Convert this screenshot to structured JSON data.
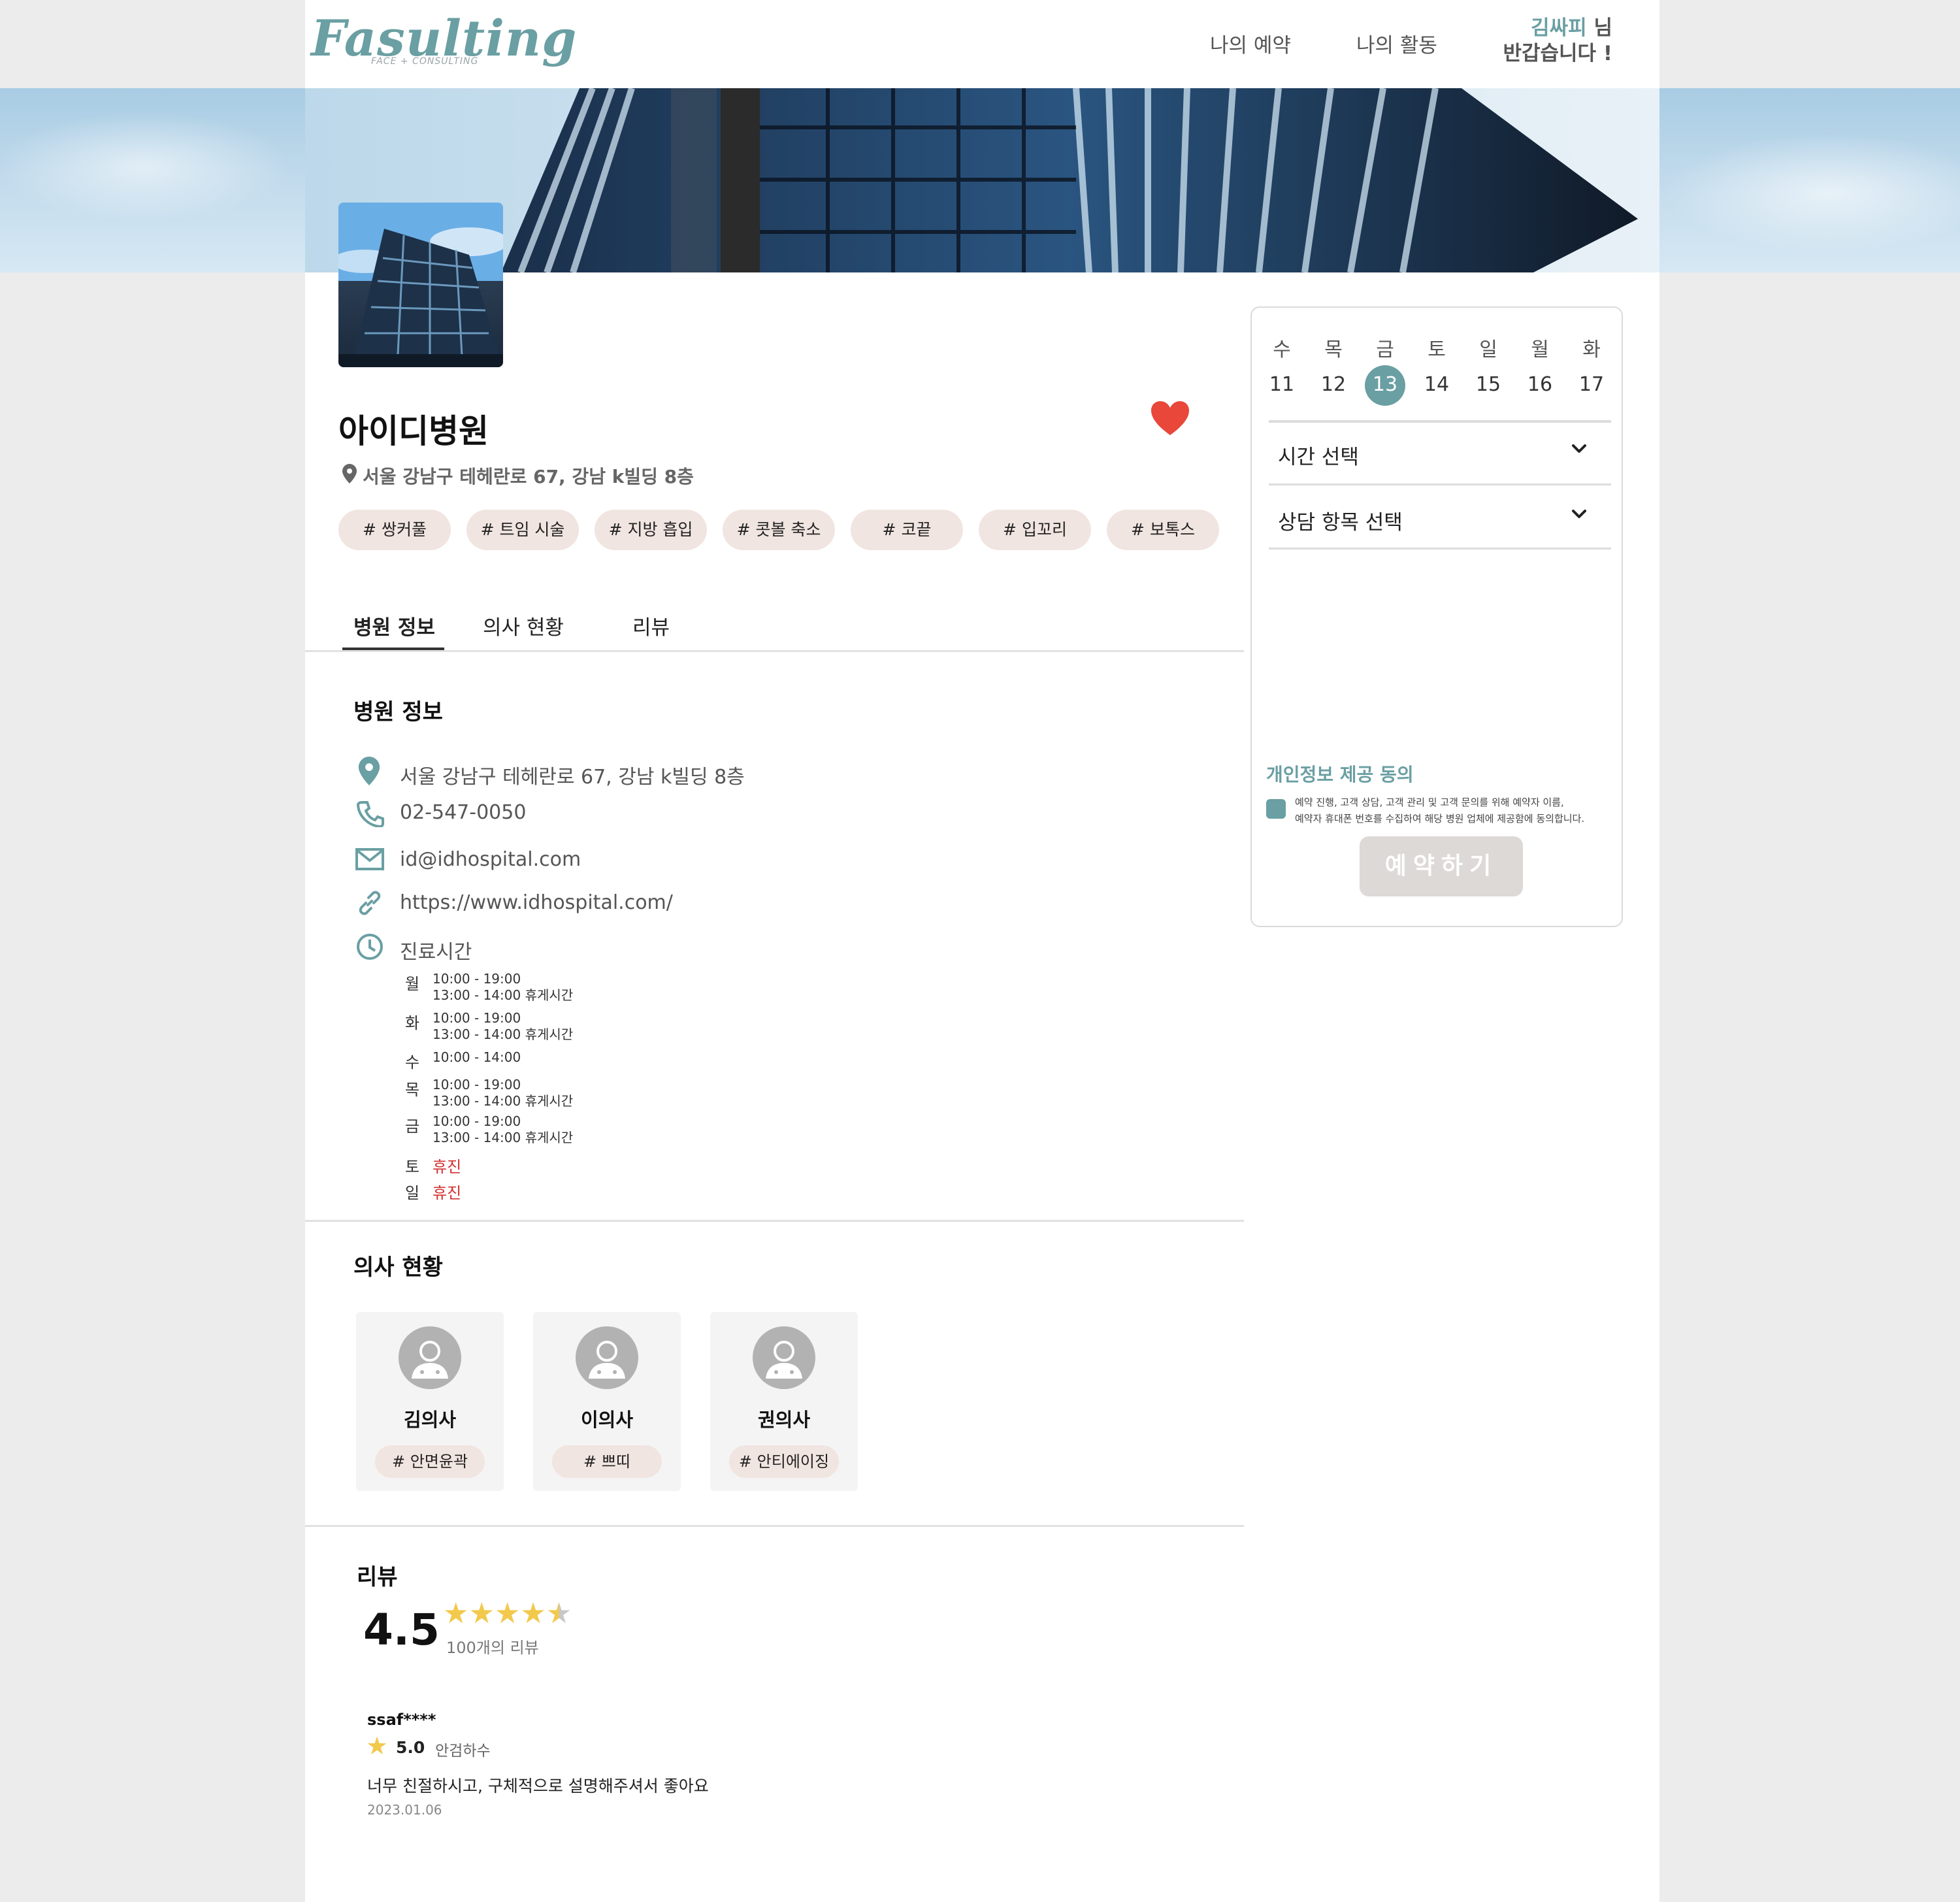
{
  "header": {
    "logo": "Fasulting",
    "logo_sub": "FACE + CONSULTING",
    "nav": [
      "나의 예약",
      "나의 활동"
    ],
    "user_name": "김싸피",
    "user_suffix": " 님",
    "greeting": "반갑습니다 !"
  },
  "hospital": {
    "name": "아이디병원",
    "address": "서울 강남구 테헤란로 67, 강남 k빌딩 8층",
    "tags": [
      "# 쌍커풀",
      "# 트임 시술",
      "# 지방 흡입",
      "# 콧볼 축소",
      "# 코끝",
      "# 입꼬리",
      "# 보톡스"
    ]
  },
  "tabs": [
    "병원 정보",
    "의사 현황",
    "리뷰"
  ],
  "info": {
    "title": "병원 정보",
    "address": "서울 강남구 테헤란로 67, 강남 k빌딩 8층",
    "phone": "02-547-0050",
    "email": "id@idhospital.com",
    "website": "https://www.idhospital.com/",
    "hours_label": "진료시간",
    "hours": [
      {
        "day": "월",
        "time": "10:00 - 19:00",
        "break": "13:00 - 14:00 휴게시간"
      },
      {
        "day": "화",
        "time": "10:00 - 19:00",
        "break": "13:00 - 14:00 휴게시간"
      },
      {
        "day": "수",
        "time": "10:00 - 14:00",
        "break": ""
      },
      {
        "day": "목",
        "time": "10:00 - 19:00",
        "break": "13:00 - 14:00 휴게시간"
      },
      {
        "day": "금",
        "time": "10:00 - 19:00",
        "break": "13:00 - 14:00 휴게시간"
      },
      {
        "day": "토",
        "closed": "휴진"
      },
      {
        "day": "일",
        "closed": "휴진"
      }
    ]
  },
  "doctors": {
    "title": "의사 현황",
    "list": [
      {
        "name": "김의사",
        "tag": "# 안면윤곽"
      },
      {
        "name": "이의사",
        "tag": "# 쁘띠"
      },
      {
        "name": "권의사",
        "tag": "# 안티에이징"
      }
    ]
  },
  "reviews": {
    "title": "리뷰",
    "rating": "4.5",
    "rating_value": 4.5,
    "count_label": "100개의 리뷰",
    "items": [
      {
        "user": "ssaf****",
        "score": "5.0",
        "doctor": "안검하수",
        "text": "너무 친절하시고, 구체적으로 설명해주셔서 좋아요",
        "date": "2023.01.06"
      }
    ]
  },
  "booking": {
    "weekdays": [
      "수",
      "목",
      "금",
      "토",
      "일",
      "월",
      "화"
    ],
    "dates": [
      "11",
      "12",
      "13",
      "14",
      "15",
      "16",
      "17"
    ],
    "selected_date": "13",
    "time_select": "시간 선택",
    "item_select": "상담 항목 선택",
    "consent_title": "개인정보 제공 동의",
    "consent_line1": "예약 진행, 고객 상담, 고객 관리 및 고객 문의를 위해 예약자 이름,",
    "consent_line2": "예약자 휴대폰 번호를 수집하여 해당 병원 업체에 제공함에 동의합니다.",
    "book_button": "예약하기"
  },
  "colors": {
    "accent": "#6a9fa3",
    "tag_bg": "#f1e5e1",
    "heart": "#e8473a",
    "closed": "#d3302f",
    "star": "#f2c94c"
  }
}
